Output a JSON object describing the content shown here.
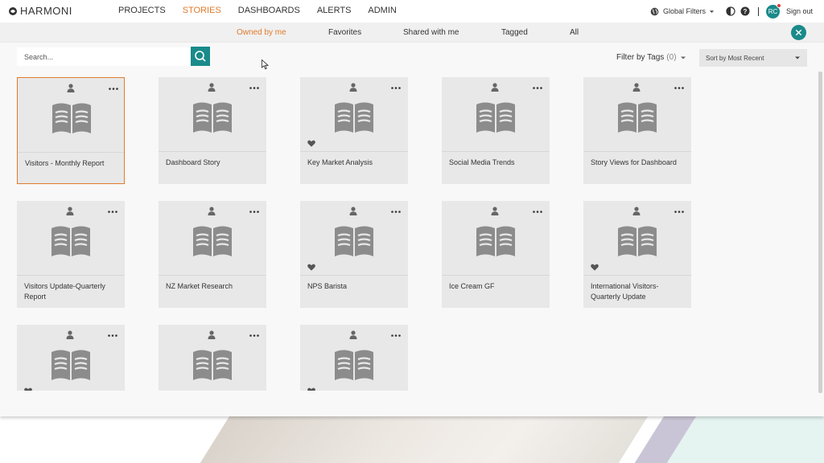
{
  "app": {
    "brand": "HARMONI"
  },
  "nav": {
    "items": [
      "PROJECTS",
      "STORIES",
      "DASHBOARDS",
      "ALERTS",
      "ADMIN"
    ],
    "active": "STORIES"
  },
  "header_tools": {
    "global_filters_label": "Global Filters",
    "avatar_initials": "RC",
    "sign_out_label": "Sign out"
  },
  "tabs": {
    "items": [
      "Owned by me",
      "Favorites",
      "Shared with me",
      "Tagged",
      "All"
    ],
    "active": "Owned by me"
  },
  "toolbar": {
    "search_placeholder": "Search...",
    "filter_label": "Filter by Tags",
    "filter_count": "(0)",
    "sort_value": "Sort by Most Recent"
  },
  "colors": {
    "accent": "#1a8a8a",
    "active_orange": "#e07b2d",
    "card_bg": "#e8e8e8",
    "icon_gray": "#888888"
  },
  "cards": [
    {
      "title": "Visitors - Monthly Report",
      "favorite": false,
      "selected": true
    },
    {
      "title": "Dashboard Story",
      "favorite": false,
      "selected": false
    },
    {
      "title": "Key Market Analysis",
      "favorite": true,
      "selected": false
    },
    {
      "title": "Social Media Trends",
      "favorite": false,
      "selected": false
    },
    {
      "title": "Story Views for Dashboard",
      "favorite": false,
      "selected": false
    },
    {
      "title": "Visitors Update-Quarterly Report",
      "favorite": false,
      "selected": false
    },
    {
      "title": "NZ Market Research",
      "favorite": false,
      "selected": false
    },
    {
      "title": "NPS Barista",
      "favorite": true,
      "selected": false
    },
    {
      "title": "Ice Cream GF",
      "favorite": false,
      "selected": false
    },
    {
      "title": "International Visitors-Quarterly Update",
      "favorite": true,
      "selected": false
    },
    {
      "title": "",
      "favorite": true,
      "selected": false
    },
    {
      "title": "",
      "favorite": false,
      "selected": false
    },
    {
      "title": "",
      "favorite": true,
      "selected": false
    }
  ]
}
